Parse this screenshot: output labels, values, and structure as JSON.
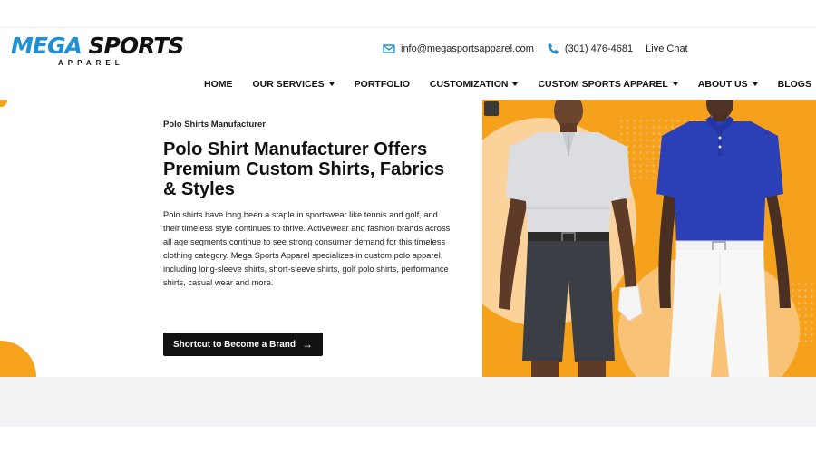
{
  "brand": {
    "logo_word_1": "MEGA",
    "logo_word_2": "SPORTS",
    "logo_sub": "APPAREL",
    "accent_orange": "#f5a11c",
    "accent_blue": "#1f8fd6"
  },
  "contact": {
    "email": "info@megasportsapparel.com",
    "phone": "(301) 476-4681",
    "chat": "Live Chat",
    "email_icon": "mail-icon",
    "phone_icon": "phone-icon"
  },
  "nav": {
    "items": [
      {
        "label": "HOME",
        "dropdown": false
      },
      {
        "label": "OUR SERVICES",
        "dropdown": true
      },
      {
        "label": "PORTFOLIO",
        "dropdown": false
      },
      {
        "label": "CUSTOMIZATION",
        "dropdown": true
      },
      {
        "label": "CUSTOM SPORTS APPAREL",
        "dropdown": true
      },
      {
        "label": "ABOUT US",
        "dropdown": true
      },
      {
        "label": "BLOGS",
        "dropdown": false
      }
    ]
  },
  "hero": {
    "eyebrow": "Polo Shirts Manufacturer",
    "headline": "Polo Shirt Manufacturer Offers Premium Custom Shirts, Fabrics & Styles",
    "body": "Polo shirts have long been a staple in sportswear like tennis and golf, and their timeless style continues to thrive. Activewear and fashion brands across all age segments continue to see strong consumer demand for this timeless clothing category. Mega Sports Apparel specializes in custom polo apparel, including long-sleeve shirts, short-sleeve shirts, golf polo shirts, performance shirts, casual wear and more.",
    "cta_label": "Shortcut to Become a Brand",
    "cta_icon": "arrow-right-icon"
  }
}
